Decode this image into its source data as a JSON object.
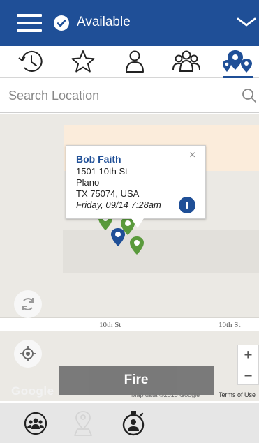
{
  "header": {
    "status_label": "Available",
    "icons": [
      "menu-icon",
      "check-circle-icon",
      "chevron-down-icon"
    ],
    "color": "#1f4f97"
  },
  "tabs": [
    {
      "icon": "history-icon"
    },
    {
      "icon": "star-icon"
    },
    {
      "icon": "person-icon"
    },
    {
      "icon": "group-icon"
    },
    {
      "icon": "map-pins-icon",
      "active": true
    }
  ],
  "search": {
    "placeholder": "Search Location"
  },
  "map": {
    "street_label_1": "10th St",
    "street_label_2": "10th St",
    "popup": {
      "name": "Bob Faith",
      "address_line": "1501 10th St",
      "city": "Plano",
      "state_zip": "TX 75074, USA",
      "timestamp": "Friday, 09/14 7:28am",
      "close_glyph": "×"
    },
    "zoom_in": "+",
    "zoom_out": "−",
    "logo": "Google",
    "attribution": "Map data ©2018 Google",
    "terms": "Terms of Use"
  },
  "fire_button": {
    "label": "Fire"
  },
  "bottom_nav": [
    {
      "icon": "group-circle-icon"
    },
    {
      "icon": "location-person-icon"
    },
    {
      "icon": "stopwatch-person-icon"
    }
  ],
  "colors": {
    "brand": "#1f4f97",
    "pin_green": "#5a9a3c",
    "pin_blue": "#1f4f97"
  }
}
